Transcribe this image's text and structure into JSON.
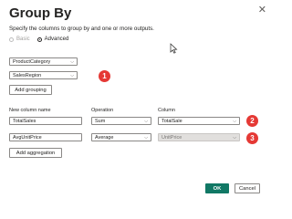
{
  "dialog": {
    "title": "Group By",
    "close_icon": "close-icon",
    "description": "Specify the columns to group by and one or more outputs.",
    "mode_options": [
      {
        "label": "Basic",
        "selected": false
      },
      {
        "label": "Advanced",
        "selected": true
      }
    ]
  },
  "grouping": {
    "columns": [
      "ProductCategory",
      "SalesRegion"
    ],
    "add_button_label": "Add grouping"
  },
  "aggregations": {
    "headers": {
      "name": "New column name",
      "operation": "Operation",
      "column": "Column"
    },
    "rows": [
      {
        "name": "TotalSales",
        "operation": "Sum",
        "column": "TotalSale",
        "column_disabled": false
      },
      {
        "name": "AvgUnitPrice",
        "operation": "Average",
        "column": "UnitPrice",
        "column_disabled": true
      }
    ],
    "add_button_label": "Add aggregation"
  },
  "callouts": [
    "1",
    "2",
    "3"
  ],
  "footer": {
    "ok_label": "OK",
    "cancel_label": "Cancel"
  },
  "colors": {
    "primary": "#117865",
    "callout": "#e53935"
  }
}
